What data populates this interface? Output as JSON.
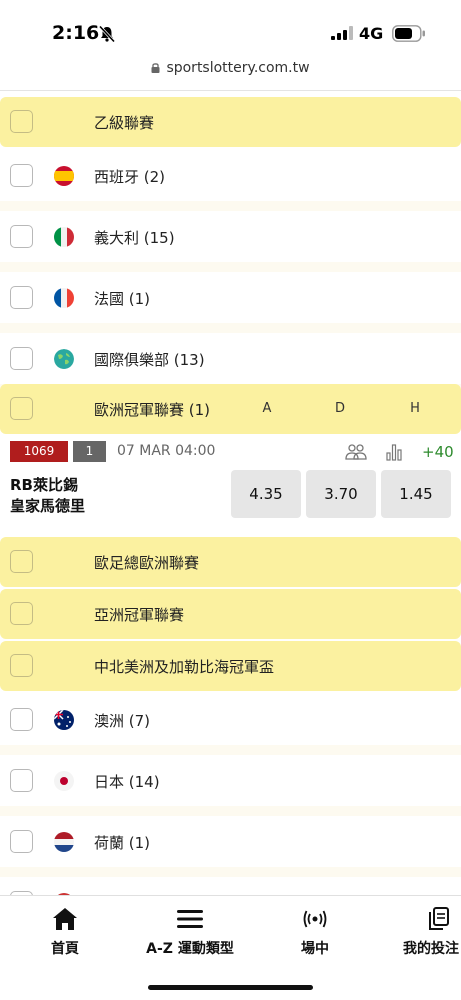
{
  "status_bar": {
    "time": "2:16",
    "network": "4G"
  },
  "browser": {
    "url": "sportslottery.com.tw"
  },
  "colors": {
    "league_bg": "#fbf1a0",
    "badge_red": "#b01d1d",
    "odds_bg": "#e6e6e6",
    "more_green": "#2e8b2e"
  },
  "rows": [
    {
      "type": "league",
      "label": "乙級聯賽"
    },
    {
      "type": "country",
      "label": "西班牙 (2)",
      "flag": "spain-flag-icon"
    },
    {
      "type": "country",
      "label": "義大利 (15)",
      "flag": "italy-flag-icon"
    },
    {
      "type": "country",
      "label": "法國 (1)",
      "flag": "france-flag-icon"
    },
    {
      "type": "country",
      "label": "國際俱樂部 (13)",
      "flag": "globe-icon"
    },
    {
      "type": "league",
      "label": "歐洲冠軍聯賽 (1)"
    }
  ],
  "odds_headers": [
    "A",
    "D",
    "H"
  ],
  "match": {
    "number": "1069",
    "tag": "1",
    "datetime": "07 MAR 04:00",
    "more": "+40",
    "team_home": "RB萊比錫",
    "team_away": "皇家馬德里",
    "odds": [
      "4.35",
      "3.70",
      "1.45"
    ]
  },
  "rows_after": [
    {
      "type": "league",
      "label": "歐足總歐洲聯賽"
    },
    {
      "type": "league",
      "label": "亞洲冠軍聯賽"
    },
    {
      "type": "league",
      "label": "中北美洲及加勒比海冠軍盃"
    },
    {
      "type": "country",
      "label": "澳洲 (7)",
      "flag": "australia-flag-icon"
    },
    {
      "type": "country",
      "label": "日本 (14)",
      "flag": "japan-flag-icon"
    },
    {
      "type": "country",
      "label": "荷蘭 (1)",
      "flag": "netherlands-flag-icon"
    }
  ],
  "tabs": [
    {
      "label": "首頁",
      "icon": "home-icon"
    },
    {
      "label": "A-Z 運動類型",
      "icon": "menu-icon"
    },
    {
      "label": "場中",
      "icon": "live-icon"
    },
    {
      "label": "我的投注",
      "icon": "copy-icon"
    }
  ]
}
